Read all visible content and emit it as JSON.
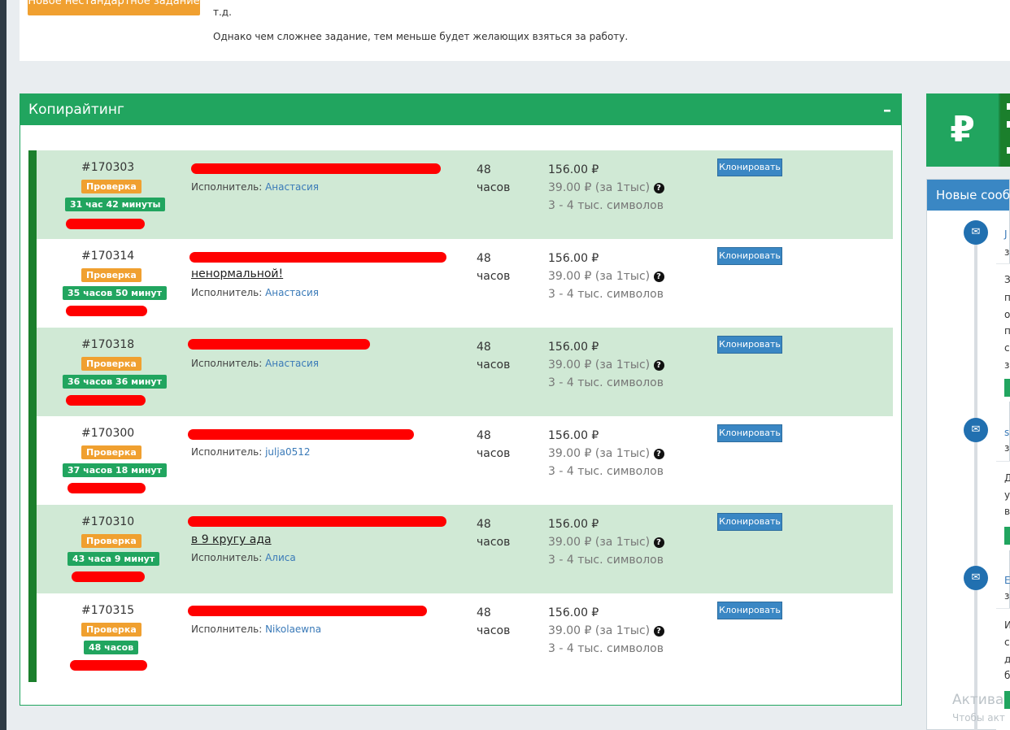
{
  "top": {
    "button_label": "Новое нестандартное задание",
    "line1": "т.д.",
    "line2": "Однако чем сложнее задание, тем меньше будет желающих взяться за работу."
  },
  "panel": {
    "title": "Копирайтинг",
    "collapse": "–"
  },
  "common": {
    "status": "Проверка",
    "executor_label": "Исполнитель:",
    "hours_line1": "48",
    "hours_line2": "часов",
    "price": "156.00 ₽",
    "rate": "39.00 ₽ (за 1тыс)",
    "volume": "3 - 4 тыс. символов",
    "clone_label": "Клонировать"
  },
  "tasks": [
    {
      "id": "#170303",
      "timer": "31 час 42 минуты",
      "title": "",
      "executor": "Анастасия"
    },
    {
      "id": "#170314",
      "timer": "35 часов 50 минут",
      "title": "ненормальной!",
      "executor": "Анастасия"
    },
    {
      "id": "#170318",
      "timer": "36 часов 36 минут",
      "title": "",
      "executor": "Анастасия"
    },
    {
      "id": "#170300",
      "timer": "37 часов 18 минут",
      "title": "",
      "executor": "julja0512"
    },
    {
      "id": "#170310",
      "timer": "43 часа 9 минут",
      "title": "в 9 кругу ада",
      "executor": "Алиса"
    },
    {
      "id": "#170315",
      "timer": "48 часов",
      "title": "",
      "executor": "Nikolaewna"
    }
  ],
  "side": {
    "ruble_symbol": "₽",
    "messages_title": "Новые сообщения",
    "msg1_name": "J",
    "msg1_sub": "з",
    "msg1_lines": [
      "З",
      "п",
      "о",
      "п",
      "с",
      "з"
    ],
    "msg2_name": "s",
    "msg2_sub": "з",
    "msg2_lines": [
      "Д",
      "у",
      "в"
    ],
    "msg3_name": "E",
    "msg3_sub": "з",
    "msg3_lines": [
      "И",
      "с",
      "д",
      "б"
    ]
  },
  "watermark": {
    "line1": "Актива",
    "line2": "Чтобы акт"
  },
  "colors": {
    "green": "#21a55f",
    "dark_green": "#1b7f2c",
    "row_alt": "#d0e9d5",
    "orange": "#f0a030",
    "blue": "#3a87c4",
    "redaction": "#ff0000"
  },
  "icons": [
    "envelope-icon",
    "question-icon",
    "ruble-icon"
  ]
}
